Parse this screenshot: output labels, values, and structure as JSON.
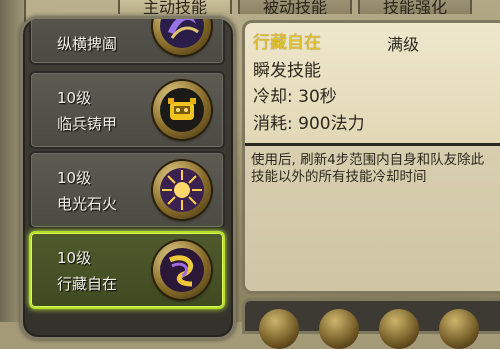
{
  "tabs": [
    {
      "label": "主动技能",
      "active": true
    },
    {
      "label": "被动技能",
      "active": false
    },
    {
      "label": "技能强化",
      "active": false
    }
  ],
  "skills": [
    {
      "level": "",
      "name": "纵横捭阖",
      "icon": "purple-swirl-icon"
    },
    {
      "level": "10级",
      "name": "临兵铸甲",
      "icon": "golden-armor-icon"
    },
    {
      "level": "10级",
      "name": "电光石火",
      "icon": "spark-burst-icon"
    },
    {
      "level": "10级",
      "name": "行藏自在",
      "icon": "purple-gold-swirl-icon",
      "selected": true
    }
  ],
  "detail": {
    "title": "行藏自在",
    "level": "满级",
    "type": "瞬发技能",
    "cooldown": "冷却: 30秒",
    "cost": "消耗: 900法力",
    "description": "使用后, 刷新4步范围内自身和队友除此技能以外的所有技能冷却时间"
  },
  "colors": {
    "selected_border": "#b8e02a",
    "title_gold": "#e7c227",
    "panel_dark": "#444239"
  }
}
